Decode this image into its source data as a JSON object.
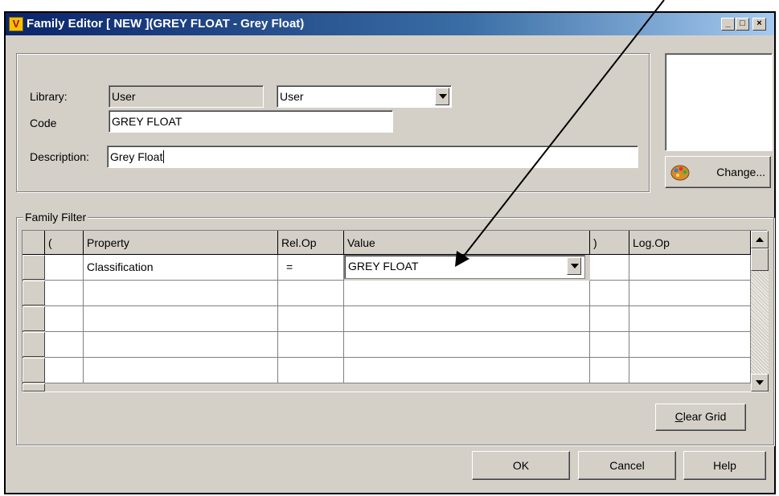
{
  "window": {
    "title": "Family Editor  [ NEW ](GREY FLOAT - Grey Float)",
    "app_icon_glyph": "V",
    "minimize_glyph": "_",
    "maximize_glyph": "□",
    "close_glyph": "×"
  },
  "form": {
    "library_label": "Library:",
    "library_value": "User",
    "library_select_value": "User",
    "code_label": "Code",
    "code_value": "GREY FLOAT",
    "description_label": "Description:",
    "description_value": "Grey Float"
  },
  "image_panel": {
    "change_label": "Change..."
  },
  "family_filter": {
    "group_label": "Family Filter",
    "columns": [
      "(",
      "Property",
      "Rel.Op",
      "Value",
      ")",
      "Log.Op"
    ],
    "rows": [
      [
        "",
        "Classification",
        "=",
        "GREY FLOAT",
        "",
        ""
      ]
    ],
    "clear_grid_label": "Clear Grid"
  },
  "buttons": {
    "ok": "OK",
    "cancel": "Cancel",
    "help": "Help"
  },
  "colors": {
    "titlebar_start": "#0a246a",
    "titlebar_end": "#a6caf0",
    "dialog_face": "#d4d0c8"
  }
}
